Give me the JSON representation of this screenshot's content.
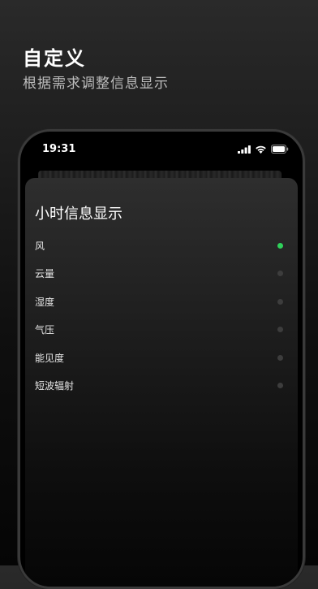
{
  "promo": {
    "title": "自定义",
    "subtitle": "根据需求调整信息显示"
  },
  "status_bar": {
    "time": "19:31",
    "icons": [
      "signal-icon",
      "wifi-icon",
      "battery-icon"
    ]
  },
  "sheet": {
    "title": "小时信息显示",
    "options": [
      {
        "label": "风",
        "enabled": true
      },
      {
        "label": "云量",
        "enabled": false
      },
      {
        "label": "湿度",
        "enabled": false
      },
      {
        "label": "气压",
        "enabled": false
      },
      {
        "label": "能见度",
        "enabled": false
      },
      {
        "label": "短波辐射",
        "enabled": false
      }
    ]
  },
  "colors": {
    "enabled_dot": "#2fd15a",
    "disabled_dot": "#3d3d3d"
  }
}
